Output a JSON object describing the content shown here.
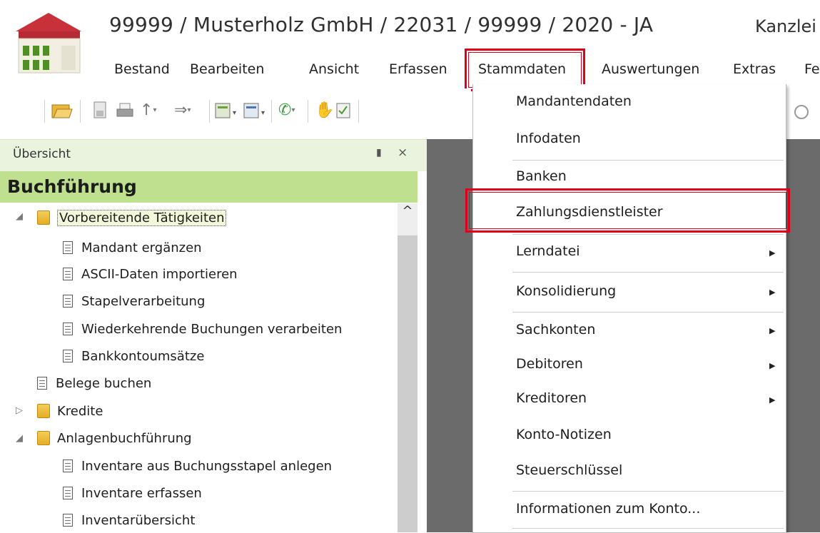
{
  "header": {
    "title": "99999 / Musterholz GmbH / 22031 / 99999 / 2020 - JA",
    "title_right": "Kanzlei"
  },
  "menubar": {
    "items": [
      "Bestand",
      "Bearbeiten",
      "Ansicht",
      "Erfassen",
      "Stammdaten",
      "Auswertungen",
      "Extras",
      "Fe"
    ],
    "active": "Stammdaten"
  },
  "toolbar": {
    "icons": [
      "open-folder-icon",
      "save-icon",
      "print-icon",
      "arrow-up-icon",
      "arrow-right-icon",
      "sheet-icon",
      "table-icon",
      "phone-icon",
      "handshake-icon",
      "checklist-icon",
      "clock-icon"
    ]
  },
  "panel": {
    "header": "Übersicht",
    "section_title": "Buchführung",
    "tree": [
      {
        "label": "Vorbereitende Tätigkeiten",
        "type": "folder",
        "expanded": true,
        "selected": true
      },
      {
        "label": "Mandant ergänzen",
        "type": "doc"
      },
      {
        "label": "ASCII-Daten importieren",
        "type": "doc"
      },
      {
        "label": "Stapelverarbeitung",
        "type": "doc"
      },
      {
        "label": "Wiederkehrende Buchungen verarbeiten",
        "type": "doc"
      },
      {
        "label": "Bankkontoumsätze",
        "type": "doc"
      },
      {
        "label": "Belege buchen",
        "type": "doc"
      },
      {
        "label": "Kredite",
        "type": "folder",
        "expanded": false
      },
      {
        "label": "Anlagenbuchführung",
        "type": "folder",
        "expanded": true
      },
      {
        "label": "Inventare aus Buchungsstapel anlegen",
        "type": "doc"
      },
      {
        "label": "Inventare erfassen",
        "type": "doc"
      },
      {
        "label": "Inventarübersicht",
        "type": "doc"
      }
    ]
  },
  "dropdown": {
    "items": [
      {
        "label": "Mandantendaten"
      },
      {
        "label": "Infodaten"
      },
      {
        "label": "Banken"
      },
      {
        "label": "Zahlungsdienstleister",
        "highlighted": true
      },
      {
        "label": "Lerndatei",
        "submenu": true
      },
      {
        "label": "Konsolidierung",
        "submenu": true
      },
      {
        "label": "Sachkonten",
        "submenu": true
      },
      {
        "label": "Debitoren",
        "submenu": true
      },
      {
        "label": "Kreditoren",
        "submenu": true
      },
      {
        "label": "Konto-Notizen"
      },
      {
        "label": "Steuerschlüssel"
      },
      {
        "label": "Informationen zum Konto..."
      }
    ]
  },
  "colors": {
    "highlight_red": "#e0001a",
    "section_green": "#bfe08f",
    "panel_header_green": "#eaf3de",
    "content_gray": "#6b6b6b"
  }
}
